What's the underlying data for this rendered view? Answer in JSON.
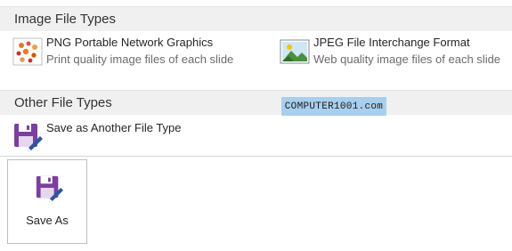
{
  "sections": {
    "image_file_types": {
      "header": "Image File Types",
      "items": [
        {
          "title": "PNG Portable Network Graphics",
          "description": "Print quality image files of each slide",
          "icon": "png-image-icon"
        },
        {
          "title": "JPEG File Interchange Format",
          "description": "Web quality image files of each slide",
          "icon": "jpeg-image-icon"
        }
      ]
    },
    "other_file_types": {
      "header": "Other File Types",
      "items": [
        {
          "title": "Save as Another File Type",
          "icon": "save-as-icon"
        }
      ]
    }
  },
  "watermark": "COMPUTER1001.com",
  "save_as_button": {
    "label": "Save As",
    "icon": "save-as-icon"
  },
  "colors": {
    "header_bg": "#f0f0f0",
    "watermark_bg": "#a9cfee",
    "save_icon_purple": "#7b3f9e"
  }
}
